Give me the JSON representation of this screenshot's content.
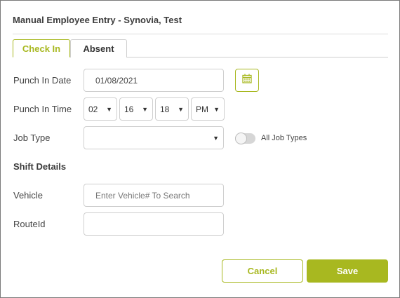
{
  "dialog": {
    "title": "Manual Employee Entry - Synovia, Test"
  },
  "tabs": [
    {
      "label": "Check In",
      "active": true
    },
    {
      "label": "Absent",
      "active": false
    }
  ],
  "form": {
    "punch_in_date": {
      "label": "Punch In Date",
      "value": "01/08/2021"
    },
    "punch_in_time": {
      "label": "Punch In Time",
      "hour": "02",
      "minute": "16",
      "second": "18",
      "meridiem": "PM"
    },
    "job_type": {
      "label": "Job Type",
      "value": ""
    },
    "all_job_types": {
      "label": "All Job Types",
      "enabled": false
    },
    "shift_details": {
      "heading": "Shift Details"
    },
    "vehicle": {
      "label": "Vehicle",
      "value": "",
      "placeholder": "Enter Vehicle# To Search"
    },
    "route_id": {
      "label": "RouteId",
      "value": ""
    }
  },
  "actions": {
    "cancel_label": "Cancel",
    "save_label": "Save"
  },
  "colors": {
    "accent": "#a8b820",
    "border": "#cfcfcf"
  },
  "icons": {
    "calendar": "calendar-icon",
    "caret": "chevron-down-icon"
  }
}
